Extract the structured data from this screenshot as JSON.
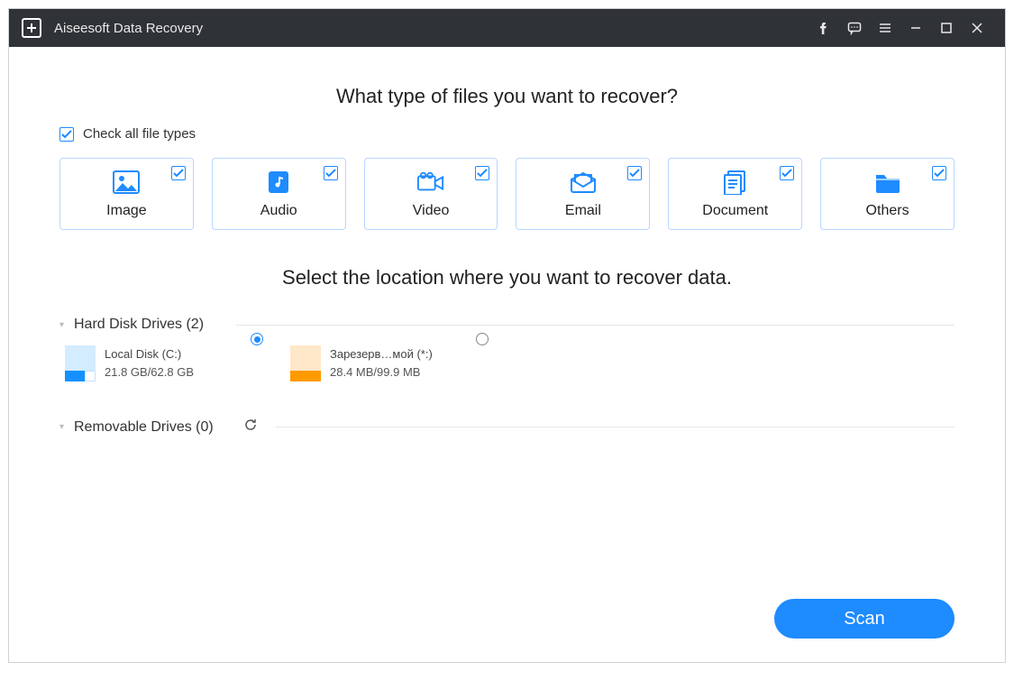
{
  "app": {
    "title": "Aiseesoft Data Recovery"
  },
  "headings": {
    "file_types": "What type of files you want to recover?",
    "location": "Select the location where you want to recover data."
  },
  "check_all": {
    "label": "Check all file types",
    "checked": true
  },
  "file_types": [
    {
      "key": "image",
      "label": "Image",
      "checked": true
    },
    {
      "key": "audio",
      "label": "Audio",
      "checked": true
    },
    {
      "key": "video",
      "label": "Video",
      "checked": true
    },
    {
      "key": "email",
      "label": "Email",
      "checked": true
    },
    {
      "key": "document",
      "label": "Document",
      "checked": true
    },
    {
      "key": "others",
      "label": "Others",
      "checked": true
    }
  ],
  "sections": {
    "hard_disk": {
      "label": "Hard Disk Drives (2)"
    },
    "removable": {
      "label": "Removable Drives (0)"
    }
  },
  "drives": [
    {
      "name": "Local Disk (C:)",
      "size": "21.8 GB/62.8 GB",
      "selected": true,
      "color": "blue"
    },
    {
      "name": "Зарезерв…мой (*:)",
      "size": "28.4 MB/99.9 MB",
      "selected": false,
      "color": "orange"
    }
  ],
  "buttons": {
    "scan": "Scan"
  },
  "colors": {
    "accent": "#1e8bff",
    "titlebar": "#2f3237"
  }
}
